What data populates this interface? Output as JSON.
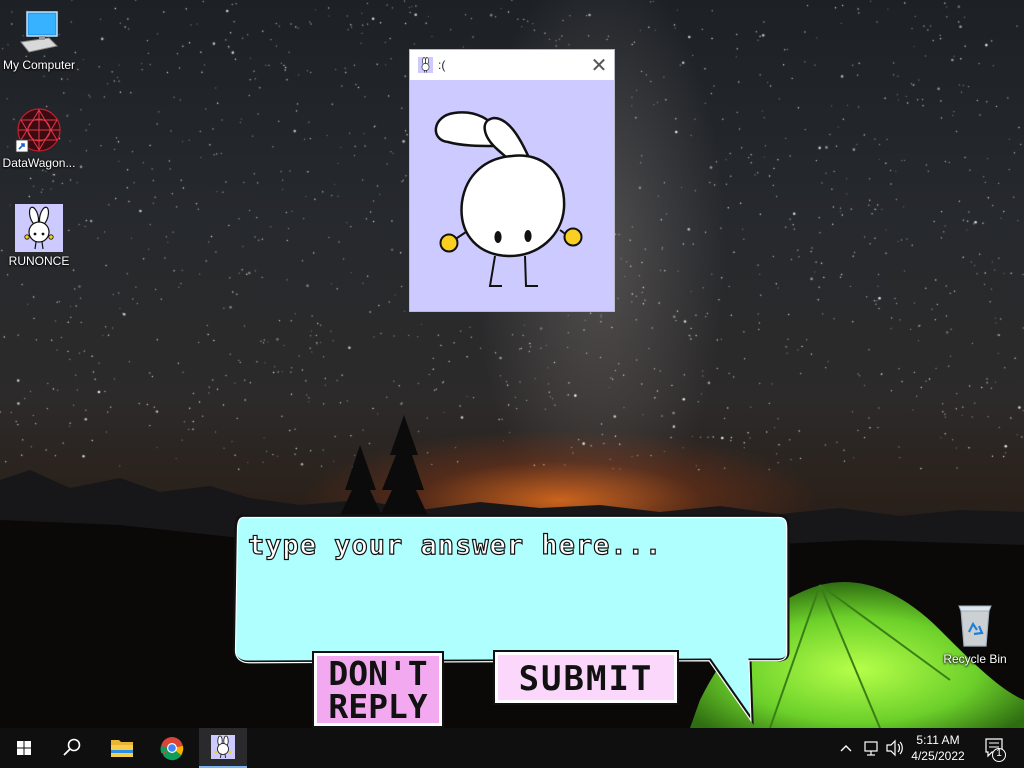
{
  "desktop": {
    "icons": [
      {
        "label": "My Computer",
        "icon": "computer-icon"
      },
      {
        "label": "DataWagon...",
        "icon": "datawagon-shortcut-icon"
      },
      {
        "label": "RUNONCE",
        "icon": "bunny-app-icon"
      },
      {
        "label": "Recycle Bin",
        "icon": "recycle-bin-icon"
      }
    ]
  },
  "popup": {
    "title": ":(",
    "close_glyph": "✕"
  },
  "reply": {
    "placeholder": "type your answer here...",
    "dont_reply_label": "DON'T REPLY",
    "submit_label": "SUBMIT"
  },
  "taskbar": {
    "start_icon": "windows-start-icon",
    "search_icon": "search-icon",
    "pinned": [
      "file-explorer-icon",
      "chrome-icon",
      "bunny-app-icon"
    ],
    "tray_icons": [
      "chevron-up-icon",
      "network-icon",
      "speaker-icon"
    ],
    "time": "5:11 AM",
    "date": "4/25/2022",
    "notification_count": "1"
  },
  "colors": {
    "bubble_fill": "#b0ffff",
    "popup_bg": "#cccaff",
    "button_pink": "#f4b6f2",
    "tent_green": "#7ee02a"
  }
}
